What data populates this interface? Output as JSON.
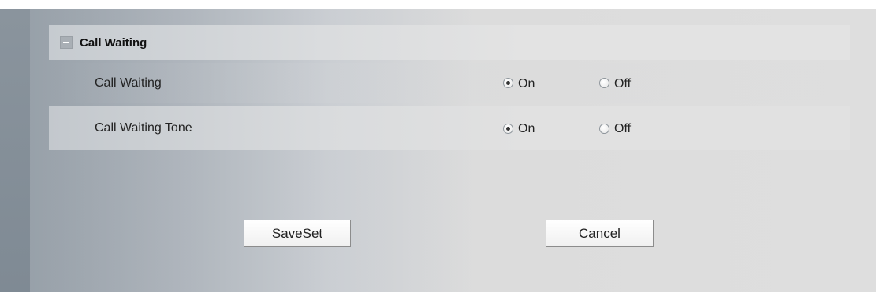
{
  "section": {
    "title": "Call Waiting",
    "icon": "collapse-icon"
  },
  "rows": [
    {
      "label": "Call Waiting",
      "options": [
        {
          "label": "On",
          "selected": true
        },
        {
          "label": "Off",
          "selected": false
        }
      ]
    },
    {
      "label": "Call Waiting Tone",
      "options": [
        {
          "label": "On",
          "selected": true
        },
        {
          "label": "Off",
          "selected": false
        }
      ]
    }
  ],
  "buttons": {
    "save_label": "SaveSet",
    "cancel_label": "Cancel"
  }
}
